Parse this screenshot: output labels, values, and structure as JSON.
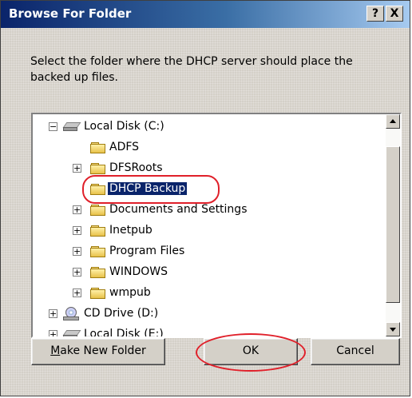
{
  "window": {
    "title": "Browse For Folder",
    "help_label": "?",
    "close_label": "X"
  },
  "instruction": "Select the folder where the DHCP server should place the backed up files.",
  "tree": {
    "items": [
      {
        "label": "Local Disk (C:)",
        "icon": "drive-icon",
        "expander": "−",
        "level": 0
      },
      {
        "label": "ADFS",
        "icon": "folder-icon",
        "expander": "",
        "level": 1
      },
      {
        "label": "DFSRoots",
        "icon": "folder-icon",
        "expander": "+",
        "level": 1
      },
      {
        "label": "DHCP Backup",
        "icon": "folder-open-icon",
        "expander": "",
        "level": 1,
        "selected": true
      },
      {
        "label": "Documents and Settings",
        "icon": "folder-icon",
        "expander": "+",
        "level": 1
      },
      {
        "label": "Inetpub",
        "icon": "folder-icon",
        "expander": "+",
        "level": 1
      },
      {
        "label": "Program Files",
        "icon": "folder-icon",
        "expander": "+",
        "level": 1
      },
      {
        "label": "WINDOWS",
        "icon": "folder-icon",
        "expander": "+",
        "level": 1
      },
      {
        "label": "wmpub",
        "icon": "folder-icon",
        "expander": "+",
        "level": 1
      },
      {
        "label": "CD Drive (D:)",
        "icon": "cd-drive-icon",
        "expander": "+",
        "level": 0
      },
      {
        "label": "Local Disk (E:)",
        "icon": "drive-icon",
        "expander": "+",
        "level": 0
      }
    ]
  },
  "buttons": {
    "make_new_folder_prefix": "M",
    "make_new_folder_rest": "ake New Folder",
    "ok": "OK",
    "cancel": "Cancel"
  },
  "colors": {
    "annotation": "#e0202a",
    "selection": "#0a246a",
    "dialog_face": "#d4d0c8"
  }
}
